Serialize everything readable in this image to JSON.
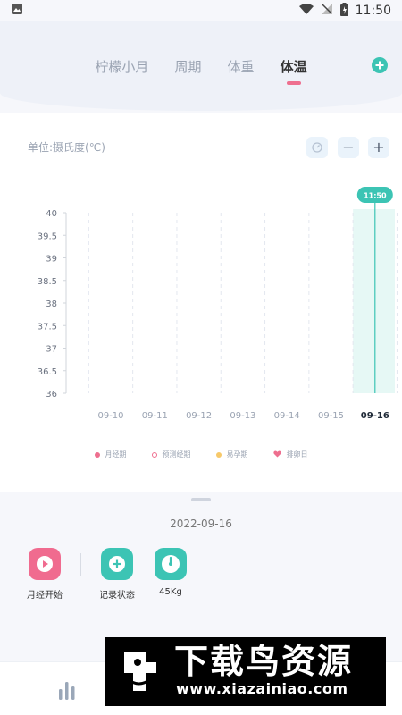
{
  "status": {
    "time": "11:50"
  },
  "header": {
    "tabs": [
      {
        "label": "柠檬小月",
        "active": false
      },
      {
        "label": "周期",
        "active": false
      },
      {
        "label": "体重",
        "active": false
      },
      {
        "label": "体温",
        "active": true
      }
    ]
  },
  "main": {
    "unit_label": "单位:摄氏度(℃)",
    "plus_symbol": "+",
    "minus_symbol": "−"
  },
  "chart_data": {
    "type": "line",
    "x": [
      "09-10",
      "09-11",
      "09-12",
      "09-13",
      "09-14",
      "09-15",
      "09-16"
    ],
    "y_ticks": [
      "40",
      "39.5",
      "39",
      "38.5",
      "38",
      "37.5",
      "37",
      "36.5",
      "36"
    ],
    "ylim": [
      36,
      40
    ],
    "series": [],
    "highlighted_x": "09-16",
    "marker_label": "11:50",
    "grid": true
  },
  "legend": [
    {
      "label": "月经期",
      "color": "#ee6f8f",
      "shape": "dot"
    },
    {
      "label": "预测经期",
      "color": "#ee6f8f",
      "shape": "ring"
    },
    {
      "label": "易孕期",
      "color": "#f7c96a",
      "shape": "dot"
    },
    {
      "label": "排卵日",
      "color": "#ee6f8f",
      "shape": "heart"
    }
  ],
  "sheet": {
    "date": "2022-09-16",
    "actions": [
      {
        "label": "月经开始",
        "color": "#f06b8f",
        "icon": "play-icon"
      },
      {
        "label": "记录状态",
        "color": "#3cc4b4",
        "icon": "plus-icon"
      },
      {
        "label": "45Kg",
        "color": "#3cc4b4",
        "icon": "scale-icon"
      }
    ]
  },
  "watermark": {
    "text_cn": "下载鸟资源",
    "url": "www.xiazainiao.com"
  }
}
